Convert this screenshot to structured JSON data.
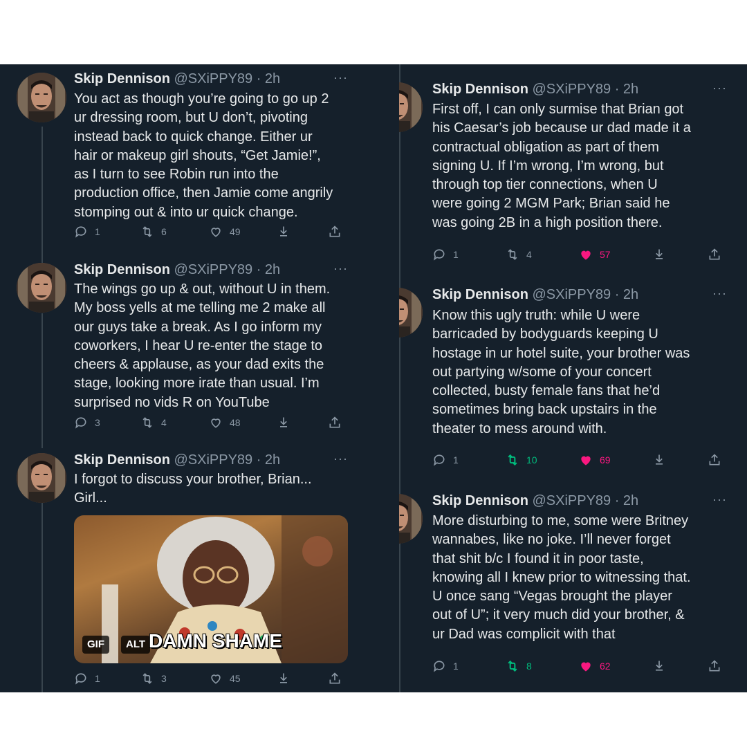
{
  "tweets": [
    {
      "name": "Skip Dennison",
      "handle": "@SXiPPY89 · 2h",
      "more": "···",
      "text": "You act as though you’re going to go up 2\nur dressing room, but U don’t, pivoting\ninstead back to quick change. Either ur\nhair or makeup girl shouts, “Get Jamie!”,\nas I turn to see Robin run into the\nproduction office, then Jamie come angrily\nstomping out & into ur quick change.",
      "replies": "1",
      "retweets": "6",
      "likes": "49"
    },
    {
      "name": "Skip Dennison",
      "handle": "@SXiPPY89 · 2h",
      "more": "···",
      "text": "The wings go up & out, without U in them.\nMy boss yells at me telling me 2 make all\nour guys take a break. As I go inform my\ncoworkers, I hear U re-enter the stage to\ncheers & applause, as your dad exits the\nstage, looking more irate than usual. I’m\nsurprised no vids R on YouTube",
      "replies": "3",
      "retweets": "4",
      "likes": "48"
    },
    {
      "name": "Skip Dennison",
      "handle": "@SXiPPY89 · 2h",
      "more": "···",
      "text": "I forgot to discuss your brother, Brian...\nGirl...",
      "media": {
        "gif_badge": "GIF",
        "alt_badge": "ALT",
        "caption": "DAMN SHAME"
      },
      "replies": "1",
      "retweets": "3",
      "likes": "45"
    },
    {
      "name": "Skip Dennison",
      "handle": "@SXiPPY89 · 2h",
      "more": "···",
      "text": "First off, I can only surmise that Brian got\nhis Caesar’s job because ur dad made it a\ncontractual obligation as part of them\nsigning U. If I’m wrong, I’m wrong, but\nthrough top tier connections, when U\nwere going 2 MGM Park; Brian said he\nwas going 2B in a high position there.",
      "replies": "1",
      "retweets": "4",
      "likes": "57"
    },
    {
      "name": "Skip Dennison",
      "handle": "@SXiPPY89 · 2h",
      "more": "···",
      "text": "Know this ugly truth: while U were\nbarricaded by bodyguards keeping U\nhostage in ur hotel suite, your brother was\nout partying w/some of your concert\ncollected, busty female fans that he’d\nsometimes bring back upstairs in the\ntheater to mess around with.",
      "replies": "1",
      "retweets": "10",
      "likes": "69"
    },
    {
      "name": "Skip Dennison",
      "handle": "@SXiPPY89 · 2h",
      "more": "···",
      "text": "More disturbing to me, some were Britney\nwannabes, like no joke. I’ll never forget\nthat shit b/c I found it in poor taste,\nknowing all I knew prior to witnessing that.\nU once sang “Vegas brought the player\nout of U”; it very much did your brother, &\nur Dad was complicit with that",
      "replies": "1",
      "retweets": "8",
      "likes": "62"
    }
  ],
  "colors": {
    "background": "#15202b",
    "text": "#e7e9ea",
    "muted": "#8b98a5",
    "retweet_active": "#00ba7c",
    "like_active": "#f91880"
  },
  "icons": [
    "reply-icon",
    "retweet-icon",
    "like-icon",
    "download-icon",
    "share-icon",
    "more-icon"
  ]
}
